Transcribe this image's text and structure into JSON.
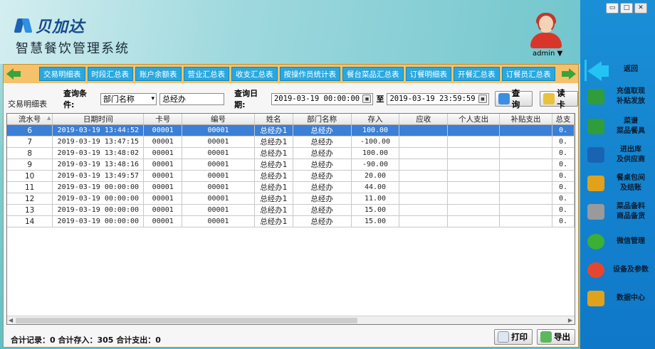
{
  "header": {
    "logo_text": "贝加达",
    "app_title": "智慧餐饮管理系统",
    "user_name": "admin ▼"
  },
  "window": {
    "minimize": "▭",
    "maximize": "□",
    "close": "✕"
  },
  "sidebar": {
    "items": [
      {
        "label": "返回",
        "icon": "back-arrow-icon",
        "color": "#23c4f4"
      },
      {
        "label": "充值取现\n补贴发放",
        "icon": "money-icon",
        "color": "#2f9e3a"
      },
      {
        "label": "菜谱\n菜品餐具",
        "icon": "cart-icon",
        "color": "#2f9e3a"
      },
      {
        "label": "进出库\n及供应商",
        "icon": "warehouse-icon",
        "color": "#1a63b3"
      },
      {
        "label": "餐桌包间\n及结账",
        "icon": "payment-icon",
        "color": "#e0a21a"
      },
      {
        "label": "菜品备料\n商品备货",
        "icon": "box-icon",
        "color": "#9a9a9a"
      },
      {
        "label": "微信管理",
        "icon": "wechat-icon",
        "color": "#3cb034"
      },
      {
        "label": "设备及参数",
        "icon": "gear-icon",
        "color": "#e6462f"
      },
      {
        "label": "数据中心",
        "icon": "chart-icon",
        "color": "#e0a21a"
      }
    ]
  },
  "tabs": [
    "交易明细表",
    "时段汇总表",
    "账户余额表",
    "营业汇总表",
    "收支汇总表",
    "按操作员统计表",
    "餐台菜品汇总表",
    "订餐明细表",
    "开餐汇总表",
    "订餐员汇总表"
  ],
  "section_title": "交易明细表",
  "query": {
    "label": "查询条件:",
    "field_select": "部门名称",
    "field_value": "总经办",
    "date_label": "查询日期:",
    "date_from": "2019-03-19 00:00:00",
    "to_label": "至",
    "date_to": "2019-03-19 23:59:59",
    "search_label": "查询",
    "read_card_label": "读卡"
  },
  "table": {
    "columns": [
      "流水号",
      "日期时间",
      "卡号",
      "编号",
      "姓名",
      "部门名称",
      "存入",
      "应收",
      "个人支出",
      "补贴支出",
      "总支"
    ],
    "rows": [
      [
        "6",
        "2019-03-19 13:44:52",
        "00001",
        "00001",
        "总经办1",
        "总经办",
        "100.00",
        "",
        "",
        "",
        "0."
      ],
      [
        "7",
        "2019-03-19 13:47:15",
        "00001",
        "00001",
        "总经办1",
        "总经办",
        "-100.00",
        "",
        "",
        "",
        "0."
      ],
      [
        "8",
        "2019-03-19 13:48:02",
        "00001",
        "00001",
        "总经办1",
        "总经办",
        "100.00",
        "",
        "",
        "",
        "0."
      ],
      [
        "9",
        "2019-03-19 13:48:16",
        "00001",
        "00001",
        "总经办1",
        "总经办",
        "-90.00",
        "",
        "",
        "",
        "0."
      ],
      [
        "10",
        "2019-03-19 13:49:57",
        "00001",
        "00001",
        "总经办1",
        "总经办",
        "20.00",
        "",
        "",
        "",
        "0."
      ],
      [
        "11",
        "2019-03-19 00:00:00",
        "00001",
        "00001",
        "总经办1",
        "总经办",
        "44.00",
        "",
        "",
        "",
        "0."
      ],
      [
        "12",
        "2019-03-19 00:00:00",
        "00001",
        "00001",
        "总经办1",
        "总经办",
        "11.00",
        "",
        "",
        "",
        "0."
      ],
      [
        "13",
        "2019-03-19 00:00:00",
        "00001",
        "00001",
        "总经办1",
        "总经办",
        "15.00",
        "",
        "",
        "",
        "0."
      ],
      [
        "14",
        "2019-03-19 00:00:00",
        "00001",
        "00001",
        "总经办1",
        "总经办",
        "15.00",
        "",
        "",
        "",
        "0."
      ]
    ],
    "selected_row": 0
  },
  "footer": {
    "summary": "合计记录：0  合计存入：305  合计支出：0",
    "print_label": "打印",
    "export_label": "导出"
  },
  "colors": {
    "accent": "#29a8e0",
    "panel": "#f4c26b",
    "sidebar": "#1a8fd6",
    "selected_row": "#3b7fd6"
  }
}
